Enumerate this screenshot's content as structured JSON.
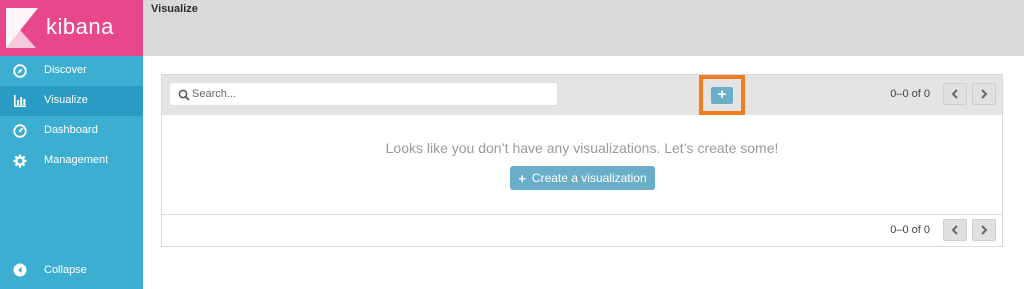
{
  "app": {
    "brand": "kibana",
    "page_title": "Visualize"
  },
  "sidebar": {
    "items": [
      {
        "label": "Discover",
        "icon": "compass-icon",
        "active": false
      },
      {
        "label": "Visualize",
        "icon": "bar-chart-icon",
        "active": true
      },
      {
        "label": "Dashboard",
        "icon": "dashboard-icon",
        "active": false
      },
      {
        "label": "Management",
        "icon": "gear-icon",
        "active": false
      }
    ],
    "collapse_label": "Collapse"
  },
  "toolbar": {
    "search_placeholder": "Search...",
    "add_label": "+",
    "pager_count": "0–0 of 0"
  },
  "main": {
    "empty_message": "Looks like you don’t have any visualizations. Let’s create some!",
    "create_plus": "+",
    "create_label": "Create a visualization"
  },
  "bottom": {
    "pager_count": "0–0 of 0"
  },
  "colors": {
    "logo_bg": "#e8488b",
    "sidebar_bg": "#3caed2",
    "sidebar_active": "#2a9cc4",
    "button_bg": "#6aaec9",
    "highlight": "#f47c1e"
  }
}
